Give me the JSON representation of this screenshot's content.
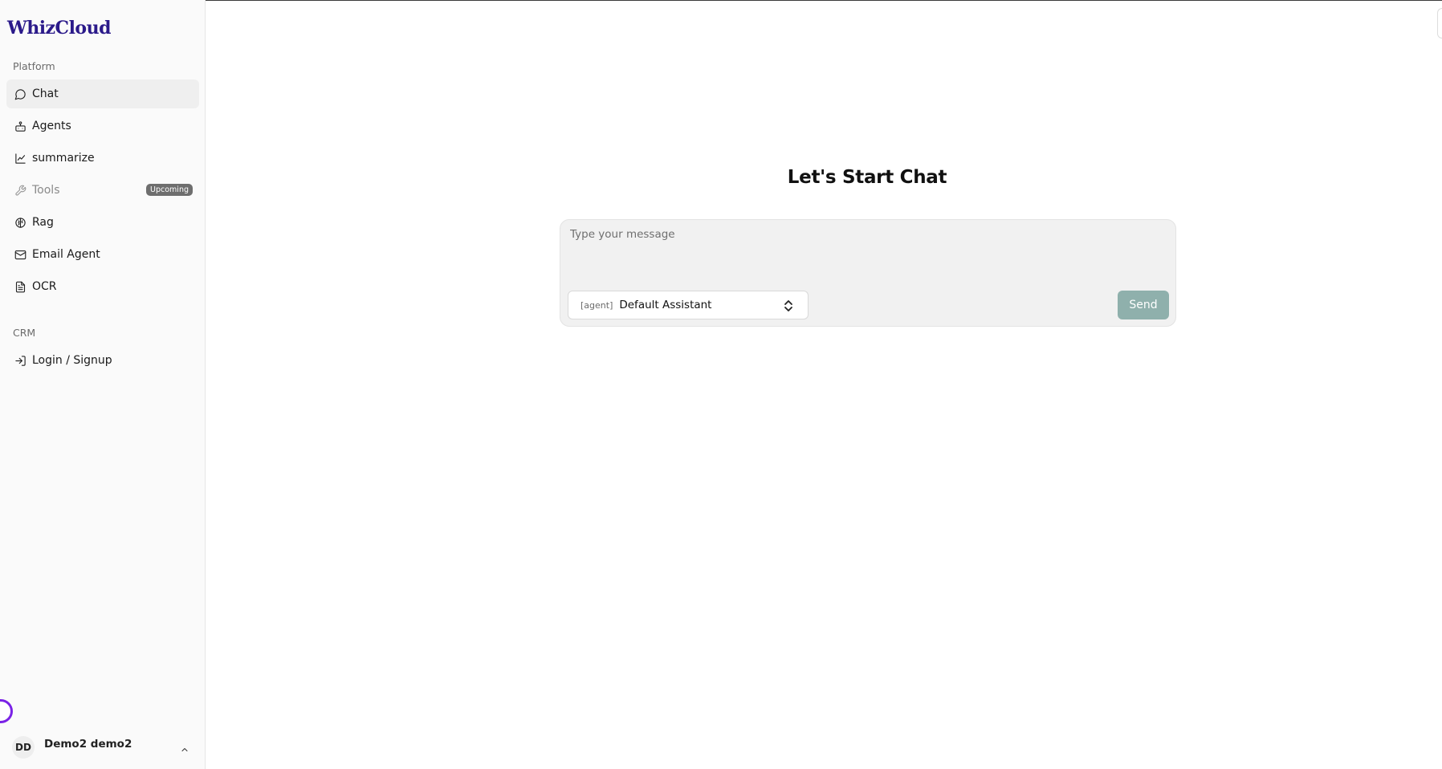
{
  "app": {
    "logo": "WhizCloud"
  },
  "sidebar": {
    "platform_label": "Platform",
    "crm_label": "CRM",
    "items": [
      {
        "label": "Chat",
        "icon": "chat-bubble-icon",
        "active": true
      },
      {
        "label": "Agents",
        "icon": "robot-icon"
      },
      {
        "label": "summarize",
        "icon": "line-chart-icon"
      },
      {
        "label": "Tools",
        "icon": "wrench-icon",
        "badge": "Upcoming",
        "disabled": true
      },
      {
        "label": "Rag",
        "icon": "brain-icon"
      },
      {
        "label": "Email Agent",
        "icon": "mail-icon"
      },
      {
        "label": "OCR",
        "icon": "document-icon"
      }
    ],
    "crm_items": [
      {
        "label": "Login / Signup",
        "icon": "login-icon"
      }
    ]
  },
  "user": {
    "initials": "DD",
    "name": "Demo2 demo2"
  },
  "main": {
    "title": "Let's Start Chat",
    "message_placeholder": "Type your message",
    "agent_tag": "[agent]",
    "agent_selected": "Default Assistant",
    "send_label": "Send"
  },
  "colors": {
    "brand": "#2b1a8a",
    "send_button": "#8fb0ac",
    "ring": "#7a22e6",
    "active_bg": "#efefef"
  }
}
